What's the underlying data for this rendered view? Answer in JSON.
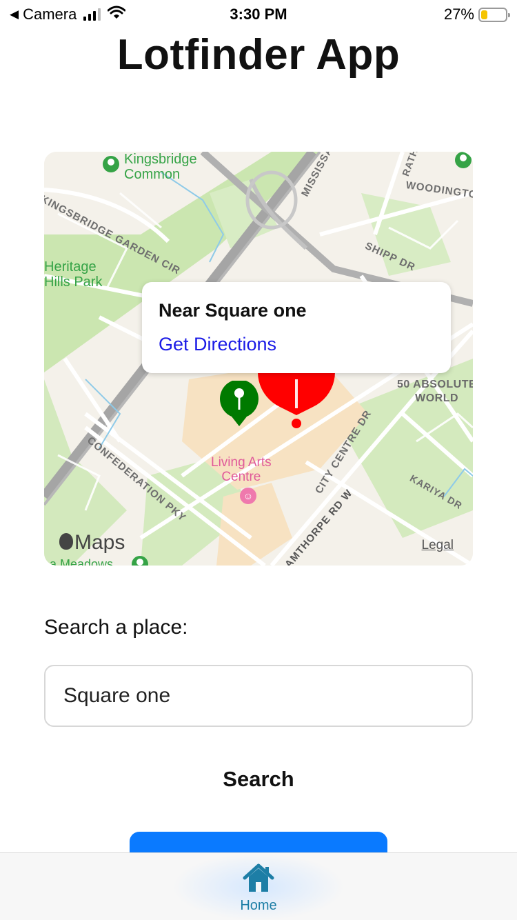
{
  "status_bar": {
    "back_label": "Camera",
    "time": "3:30 PM",
    "battery_percent": "27%",
    "battery_level": 0.27,
    "battery_color": "#f5c400",
    "back_icon": "back-triangle-icon",
    "signal_icon": "cellular-signal-icon",
    "wifi_icon": "wifi-icon"
  },
  "header": {
    "title": "Lotfinder App"
  },
  "map": {
    "callout": {
      "title": "Near Square one",
      "link": "Get Directions"
    },
    "labels": {
      "kingsbridge": "Kingsbridge\nCommon",
      "kingsbridge_garden": "KINGSBRIDGE GARDEN CIR",
      "heritage": "Heritage\nHills Park",
      "mississauga": "MISSISSA",
      "woodington": "WOODINGTO",
      "shipp": "SHIPP DR",
      "rath": "RATH",
      "absolute": "50 ABSOLUTE\nWORLD",
      "city_centre": "CITY CENTRE DR",
      "confederation": "CONFEDERATION PKY",
      "living_arts": "Living Arts\nCentre",
      "burnhamthorpe": "AMTHORPE RD W",
      "kariya": "KARIYA DR",
      "meadows": "a Meadows"
    },
    "logo": "Maps",
    "legal": "Legal",
    "pin_colors": {
      "selected": "#ff0000",
      "current": "#007a00"
    }
  },
  "search": {
    "label": "Search a place:",
    "value": "Square one",
    "button_label": "Search",
    "primary_color": "#0a7aff"
  },
  "tab_bar": {
    "home_label": "Home",
    "home_icon": "house-icon",
    "accent": "#1d7ea6"
  }
}
